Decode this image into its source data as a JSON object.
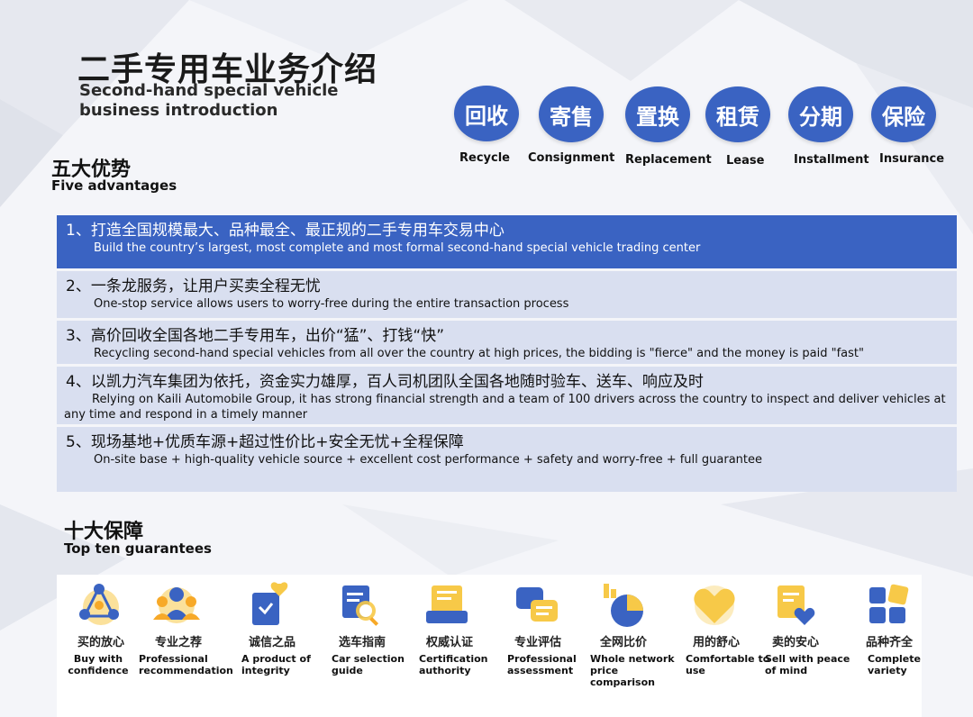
{
  "header": {
    "title_cn": "二手专用车业务介绍",
    "title_en": "Second-hand special vehicle business introduction"
  },
  "services": [
    {
      "cn": "回收",
      "en": "Recycle"
    },
    {
      "cn": "寄售",
      "en": "Consignment"
    },
    {
      "cn": "置换",
      "en": "Replacement"
    },
    {
      "cn": "租赁",
      "en": "Lease"
    },
    {
      "cn": "分期",
      "en": "Installment"
    },
    {
      "cn": "保险",
      "en": "Insurance"
    }
  ],
  "advantages_section": {
    "cn": "五大优势",
    "en": "Five advantages"
  },
  "advantages": [
    {
      "title": "1、打造全国规模最大、品种最全、最正规的二手专用车交易中心",
      "en": "Build the country’s largest, most complete and most formal second-hand special vehicle trading center"
    },
    {
      "title": "2、一条龙服务，让用户买卖全程无忧",
      "en": "One-stop service allows users to worry-free during the entire transaction process"
    },
    {
      "title": "3、高价回收全国各地二手专用车，出价“猛”、打钱“快”",
      "en": "Recycling second-hand special vehicles from all over the country at high prices, the bidding is \"fierce\" and the money is paid \"fast\""
    },
    {
      "title": "4、以凯力汽车集团为依托，资金实力雄厚，百人司机团队全国各地随时验车、送车、响应及时",
      "en": "Relying on Kaili Automobile Group, it has strong financial strength and a team of 100 drivers across the country to inspect and deliver vehicles at any time and respond in a timely manner"
    },
    {
      "title": "5、现场基地+优质车源+超过性价比+安全无忧+全程保障",
      "en": "On-site base + high-quality vehicle source + excellent cost performance + safety and worry-free + full guarantee"
    }
  ],
  "guarantees_section": {
    "cn": "十大保障",
    "en": "Top ten guarantees"
  },
  "guarantees": [
    {
      "cn": "买的放心",
      "en": "Buy with confidence",
      "icon": "people-network-icon"
    },
    {
      "cn": "专业之荐",
      "en": "Professional recommendation",
      "icon": "group-users-icon"
    },
    {
      "cn": "诚信之品",
      "en": "A product of integrity",
      "icon": "heart-document-icon"
    },
    {
      "cn": "选车指南",
      "en": "Car selection guide",
      "icon": "magnifier-document-icon"
    },
    {
      "cn": "权威认证",
      "en": "Certification authority",
      "icon": "certificate-icon"
    },
    {
      "cn": "专业评估",
      "en": "Professional assessment",
      "icon": "chat-bubbles-icon"
    },
    {
      "cn": "全网比价",
      "en": "Whole network price comparison",
      "icon": "pie-chart-icon"
    },
    {
      "cn": "用的舒心",
      "en": "Comfortable to use",
      "icon": "heart-icon"
    },
    {
      "cn": "卖的安心",
      "en": "Sell with peace of mind",
      "icon": "clipboard-heart-icon"
    },
    {
      "cn": "品种齐全",
      "en": "Complete variety",
      "icon": "grid-blocks-icon"
    }
  ],
  "colors": {
    "accent": "#3a63c2",
    "row_bg": "#d9dff0",
    "icon_yellow": "#f7c948",
    "icon_blue": "#3a63c2"
  }
}
